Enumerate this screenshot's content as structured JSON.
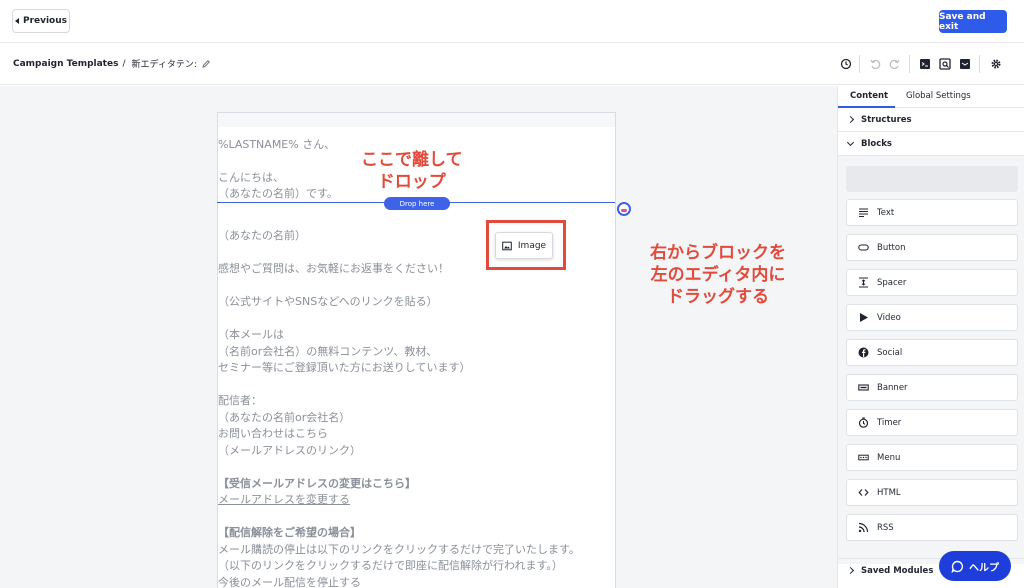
{
  "topbar": {
    "previous_label": "Previous",
    "save_label": "Save and exit"
  },
  "breadcrumb": {
    "root": "Campaign Templates",
    "separator": "/",
    "current": "新エディタテン:"
  },
  "toolbar": {
    "icons": [
      "history-icon",
      "undo-icon",
      "redo-icon",
      "code-icon",
      "preview-icon",
      "test-email-icon",
      "settings-icon"
    ]
  },
  "email": {
    "lines": [
      "%LASTNAME% さん、",
      "こんにちは、",
      "（あなたの名前）です。",
      "（あなたの名前）",
      "感想やご質問は、お気軽にお返事をください！",
      "（公式サイトやSNSなどへのリンクを貼る）",
      "（本メールは",
      "（名前or会社名）の無料コンテンツ、教材、",
      "セミナー等にご登録頂いた方にお送りしています）",
      "配信者：",
      "（あなたの名前or会社名）",
      "お問い合わせはこちら",
      "（メールアドレスのリンク）",
      "【受信メールアドレスの変更はこちら】",
      "メールアドレスを変更する",
      "【配信解除をご希望の場合】",
      "メール購読の停止は以下のリンクをクリックするだけで完了いたします。",
      "（以下のリンクをクリックするだけで即座に配信解除が行われます。）",
      "今後のメール配信を停止する"
    ],
    "drop_here": "Drop here",
    "drag_chip": "Image"
  },
  "annotations": {
    "drop_1": "ここで離して",
    "drop_2": "ドロップ",
    "drag_1": "右からブロックを",
    "drag_2": "左のエディタ内に",
    "drag_3": "ドラッグする"
  },
  "panel": {
    "tabs": [
      "Content",
      "Global Settings"
    ],
    "structures": "Structures",
    "blocks": "Blocks",
    "saved_modules": "Saved Modules",
    "block_items": [
      {
        "label": "Text",
        "icon": "text-icon"
      },
      {
        "label": "Button",
        "icon": "button-icon"
      },
      {
        "label": "Spacer",
        "icon": "spacer-icon"
      },
      {
        "label": "Video",
        "icon": "video-icon"
      },
      {
        "label": "Social",
        "icon": "facebook-icon"
      },
      {
        "label": "Banner",
        "icon": "banner-icon"
      },
      {
        "label": "Timer",
        "icon": "timer-icon"
      },
      {
        "label": "Menu",
        "icon": "menu-icon"
      },
      {
        "label": "HTML",
        "icon": "code-icon"
      },
      {
        "label": "RSS",
        "icon": "rss-icon"
      }
    ]
  },
  "help": {
    "label": "ヘルプ"
  },
  "colors": {
    "primary": "#2f5bea",
    "annotation_red": "#e24a3b",
    "drop_blue": "#3f63e8",
    "help_blue": "#1e3edb"
  }
}
